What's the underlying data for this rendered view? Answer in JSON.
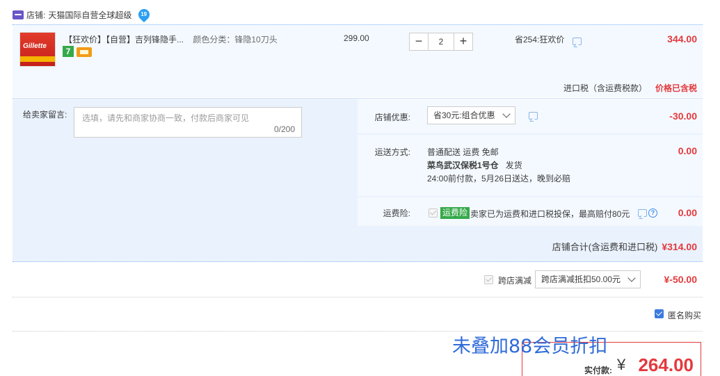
{
  "shop": {
    "label": "店铺:",
    "name": "天猫国际自营全球超级",
    "badge": "19"
  },
  "item": {
    "image_logo": "Gillette",
    "title": "【狂欢价】【自营】吉列锋隐手...",
    "sku": "颜色分类：锋隐10刀头",
    "tag_days": "7",
    "unit_price": "299.00",
    "qty_minus": "−",
    "qty_value": "2",
    "qty_plus": "+",
    "save_text": "省254:狂欢价",
    "total": "344.00",
    "tax_label": "进口税（含运费税款）",
    "tax_status": "价格已含税"
  },
  "message": {
    "label": "给卖家留言:",
    "placeholder": "选填，请先和商家协商一致，付款后商家可见",
    "count": "0/200"
  },
  "shop_discount": {
    "label": "店铺优惠:",
    "selected": "省30元:组合优惠",
    "amount": "-30.00"
  },
  "shipping": {
    "label": "运送方式:",
    "line1": "普通配送 运费 免邮",
    "line2_bold": "菜鸟武汉保税1号仓",
    "line2_rest": "发货",
    "line3": "24:00前付款，5月26日送达，晚到必赔",
    "amount": "0.00"
  },
  "insurance": {
    "label": "运费险:",
    "badge": "运费险",
    "text": "卖家已为运费和进口税投保，最高赔付80元",
    "amount": "0.00"
  },
  "shop_total": {
    "label": "店铺合计(含运费和进口税)",
    "amount": "¥314.00"
  },
  "cross_store": {
    "label": "跨店满减",
    "selected": "跨店满减抵扣50.00元",
    "amount": "¥-50.00"
  },
  "anonymous": {
    "label": "匿名购买",
    "checked": true
  },
  "overlay": {
    "text": "未叠加88会员折扣"
  },
  "payment": {
    "label": "实付款:",
    "currency": "¥",
    "amount": "264.00"
  }
}
